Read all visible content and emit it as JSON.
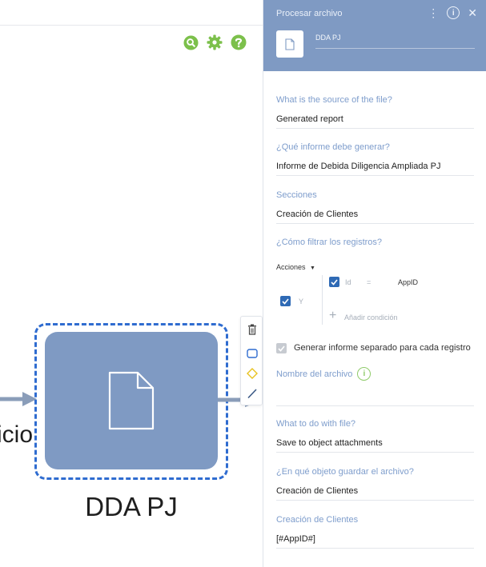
{
  "canvas": {
    "task_label": "DDA PJ",
    "prev_label_fragment": "icio",
    "toolbar_icons": [
      "search-icon",
      "gear-icon",
      "help-icon"
    ],
    "toolbar_color": "#7cc04b"
  },
  "panel": {
    "title": "Procesar archivo",
    "header_actions": [
      "more-icon",
      "info-icon",
      "close-icon"
    ],
    "name_value": "DDA PJ",
    "source": {
      "label": "What is the source of the file?",
      "value": "Generated report"
    },
    "report": {
      "label": "¿Qué informe debe generar?",
      "value": "Informe de Debida Diligencia Ampliada PJ"
    },
    "sections": {
      "label": "Secciones",
      "value": "Creación de Clientes"
    },
    "filter": {
      "label": "¿Cómo filtrar los registros?",
      "actions_label": "Acciones",
      "and_label": "Y",
      "condition": {
        "field": "Id",
        "operator": "=",
        "value": "AppID"
      },
      "add_condition_label": "Añadir condición"
    },
    "separate_report_label": "Generar informe separado para cada registro",
    "file_name": {
      "label": "Nombre del archivo"
    },
    "what_to_do": {
      "label": "What to do with file?",
      "value": "Save to object attachments"
    },
    "save_object": {
      "label": "¿En qué objeto guardar el archivo?",
      "value": "Creación de Clientes"
    },
    "object_field": {
      "label": "Creación de Clientes",
      "value": "[#AppID#]"
    }
  }
}
